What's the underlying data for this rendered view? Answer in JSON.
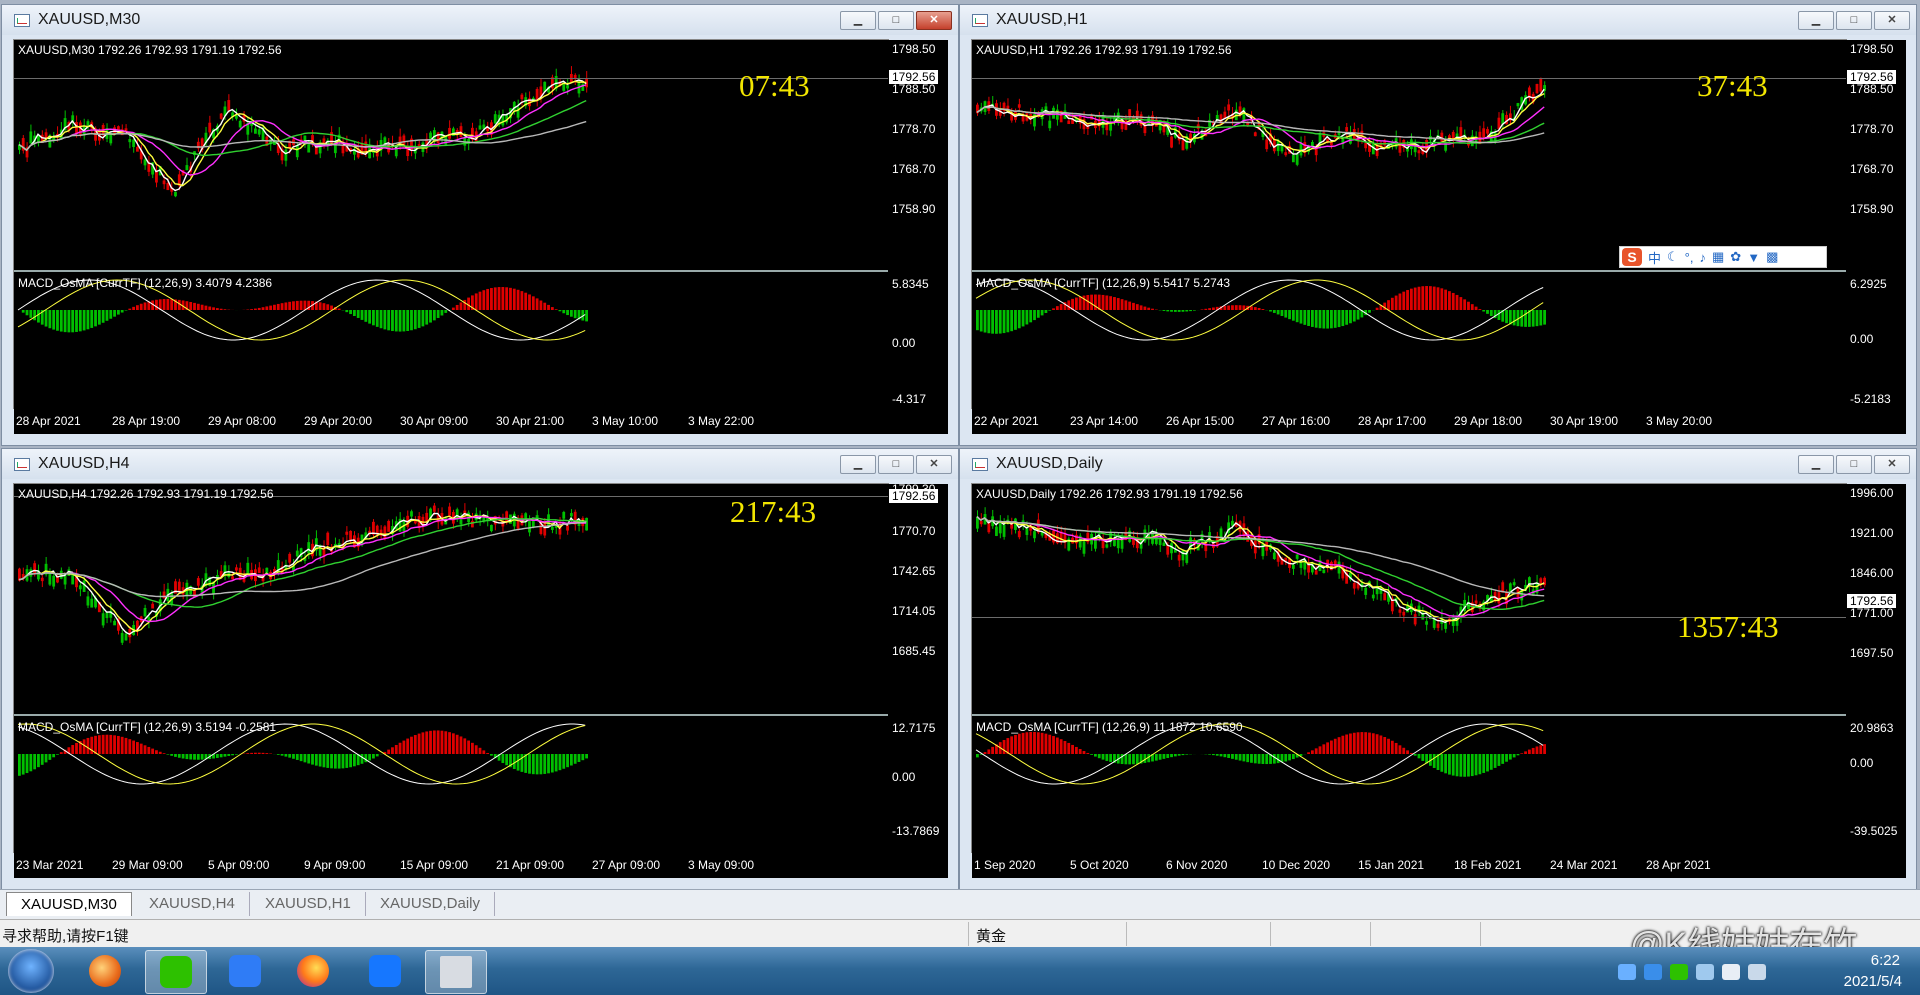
{
  "windows": [
    {
      "title": "XAUUSD,M30",
      "header": "XAUUSD,M30  1792.26 1792.93 1791.19 1792.56",
      "macd_header": "MACD_OsMA [CurrTF] (12,26,9) 3.4079 4.2386",
      "timer": "07:43",
      "current_price": "1792.56",
      "price_labels": [
        "1798.50",
        "1788.50",
        "1778.70",
        "1768.70",
        "1758.90"
      ],
      "macd_labels": [
        "5.8345",
        "0.00",
        "-4.317"
      ],
      "x_labels": [
        "28 Apr 2021",
        "28 Apr 19:00",
        "29 Apr 08:00",
        "29 Apr 20:00",
        "30 Apr 09:00",
        "30 Apr 21:00",
        "3 May 10:00",
        "3 May 22:00"
      ],
      "close_style": "red"
    },
    {
      "title": "XAUUSD,H1",
      "header": "XAUUSD,H1  1792.26 1792.93 1791.19 1792.56",
      "macd_header": "MACD_OsMA [CurrTF] (12,26,9) 5.5417 5.2743",
      "timer": "37:43",
      "current_price": "1792.56",
      "price_labels": [
        "1798.50",
        "1788.50",
        "1778.70",
        "1768.70",
        "1758.90"
      ],
      "macd_labels": [
        "6.2925",
        "0.00",
        "-5.2183"
      ],
      "x_labels": [
        "22 Apr 2021",
        "23 Apr 14:00",
        "26 Apr 15:00",
        "27 Apr 16:00",
        "28 Apr 17:00",
        "29 Apr 18:00",
        "30 Apr 19:00",
        "3 May 20:00"
      ],
      "close_style": "gray"
    },
    {
      "title": "XAUUSD,H4",
      "header": "XAUUSD,H4  1792.26 1792.93 1791.19 1792.56",
      "macd_header": "MACD_OsMA [CurrTF] (12,26,9) 3.5194 -0.2581",
      "timer": "217:43",
      "current_price": "1792.56",
      "price_labels": [
        "1799.30",
        "1770.70",
        "1742.65",
        "1714.05",
        "1685.45"
      ],
      "macd_labels": [
        "12.7175",
        "0.00",
        "-13.7869"
      ],
      "x_labels": [
        "23 Mar 2021",
        "29 Mar 09:00",
        "5 Apr 09:00",
        "9 Apr 09:00",
        "15 Apr 09:00",
        "21 Apr 09:00",
        "27 Apr 09:00",
        "3 May 09:00"
      ],
      "close_style": "gray"
    },
    {
      "title": "XAUUSD,Daily",
      "header": "XAUUSD,Daily  1792.26 1792.93 1791.19 1792.56",
      "macd_header": "MACD_OsMA [CurrTF] (12,26,9) 11.1872 10.6590",
      "timer": "1357:43",
      "current_price": "1792.56",
      "price_labels": [
        "1996.00",
        "1921.00",
        "1846.00",
        "1771.00",
        "1697.50"
      ],
      "macd_labels": [
        "20.9863",
        "0.00",
        "-39.5025"
      ],
      "x_labels": [
        "1 Sep 2020",
        "5 Oct 2020",
        "6 Nov 2020",
        "10 Dec 2020",
        "15 Jan 2021",
        "18 Feb 2021",
        "24 Mar 2021",
        "28 Apr 2021"
      ],
      "close_style": "gray"
    }
  ],
  "window_buttons": {
    "minimize": "▁",
    "maximize": "□",
    "close": "✕"
  },
  "tabs": [
    "XAUUSD,M30",
    "XAUUSD,H4",
    "XAUUSD,H1",
    "XAUUSD,Daily"
  ],
  "active_tab": 0,
  "status": {
    "help": "寻求帮助,请按F1键",
    "profile": "黄金"
  },
  "taskbar": {
    "time": "6:22",
    "date": "2021/5/4",
    "apps": [
      "firefox-like",
      "wechat",
      "feishu",
      "lark",
      "mt4"
    ]
  },
  "ime_toolbar": {
    "logo": "S",
    "lang": "中"
  },
  "watermark": "@K线姑姑在竹",
  "colors": {
    "bull": "#00c000",
    "bear": "#e00000",
    "ma_yellow": "#ffff40",
    "ma_white": "#ffffff",
    "ma_magenta": "#ff30ff",
    "ma_green": "#30d030",
    "ma_gray": "#b8b8b8",
    "timer": "#f2e600"
  }
}
